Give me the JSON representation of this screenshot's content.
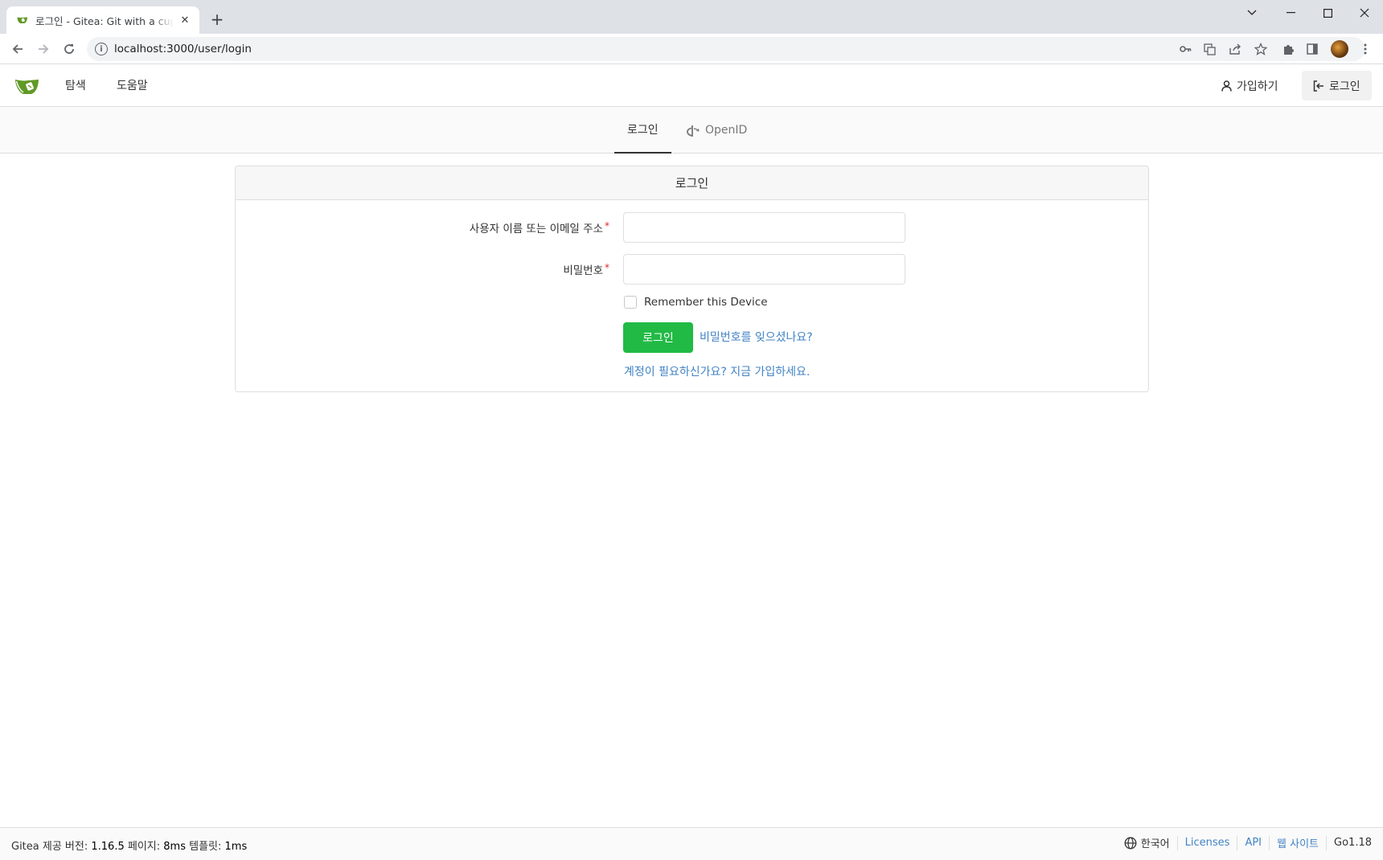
{
  "browser": {
    "tab_title": "로그인 - Gitea: Git with a cup of tea",
    "url": "localhost:3000/user/login"
  },
  "navbar": {
    "explore": "탐색",
    "help": "도움말",
    "register": "가입하기",
    "signin": "로그인"
  },
  "subnav": {
    "tab_login": "로그인",
    "tab_openid": "OpenID"
  },
  "form": {
    "header": "로그인",
    "username_label": "사용자 이름 또는 이메일 주소",
    "password_label": "비밀번호",
    "required_mark": "*",
    "remember_label": "Remember this Device",
    "submit_label": "로그인",
    "forgot_link": "비밀번호를 잊으셨나요?",
    "signup_link": "계정이 필요하신가요? 지금 가입하세요."
  },
  "footer": {
    "powered_by": "Gitea 제공 버전: ",
    "version": "1.16.5",
    "page_label": " 페이지: ",
    "page_time": "8ms",
    "template_label": " 템플릿: ",
    "template_time": "1ms",
    "language": "한국어",
    "licenses": "Licenses",
    "api": "API",
    "website": "웹 사이트",
    "go_version": "Go1.18"
  },
  "colors": {
    "primary_button": "#21ba45",
    "link": "#4183c4",
    "required": "#db2828"
  }
}
